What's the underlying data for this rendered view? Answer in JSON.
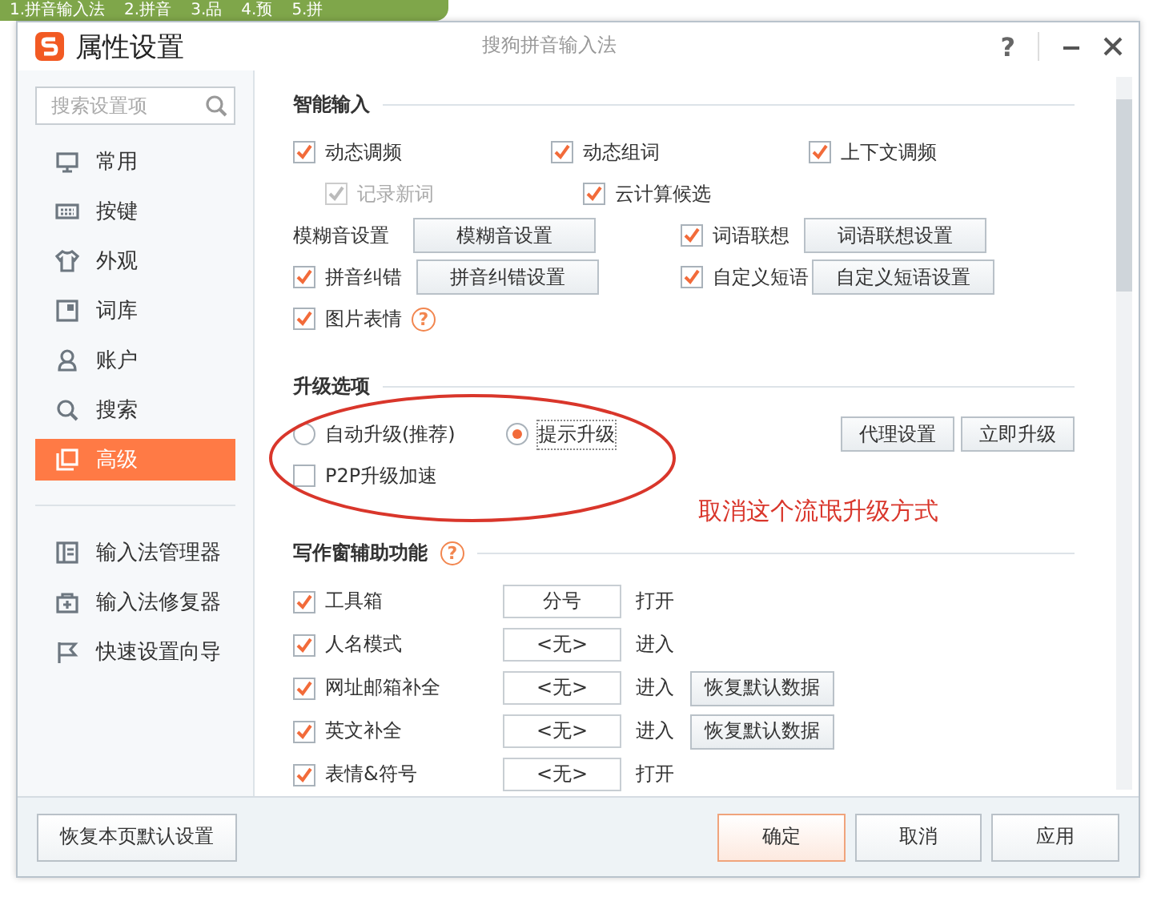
{
  "background": {
    "tabs": [
      "1.拼音输入法",
      "2.拼音",
      "3.品",
      "4.预",
      "5.拼"
    ]
  },
  "window": {
    "title": "属性设置",
    "subtitle": "搜狗拼音输入法",
    "help": "?"
  },
  "sidebar": {
    "search": {
      "placeholder": "搜索设置项"
    },
    "items": [
      {
        "label": "常用",
        "selected": false
      },
      {
        "label": "按键",
        "selected": false
      },
      {
        "label": "外观",
        "selected": false
      },
      {
        "label": "词库",
        "selected": false
      },
      {
        "label": "账户",
        "selected": false
      },
      {
        "label": "搜索",
        "selected": false
      },
      {
        "label": "高级",
        "selected": true
      }
    ],
    "tools": [
      "输入法管理器",
      "输入法修复器",
      "快速设置向导"
    ]
  },
  "smart_input": {
    "title": "智能输入",
    "options": [
      {
        "label": "动态调频",
        "checked": true,
        "disabled": false
      },
      {
        "label": "动态组词",
        "checked": true,
        "disabled": false
      },
      {
        "label": "上下文调频",
        "checked": true,
        "disabled": false
      }
    ],
    "sub_options": [
      {
        "label": "记录新词",
        "checked": true,
        "disabled": true
      },
      {
        "label": "云计算候选",
        "checked": true,
        "disabled": false
      }
    ],
    "settings": [
      {
        "kind": "label",
        "label": "模糊音设置",
        "button": "模糊音设置"
      },
      {
        "kind": "check",
        "label": "词语联想",
        "checked": true,
        "button": "词语联想设置"
      },
      {
        "kind": "check",
        "label": "拼音纠错",
        "checked": true,
        "button": "拼音纠错设置"
      },
      {
        "kind": "check",
        "label": "自定义短语",
        "checked": true,
        "button": "自定义短语设置"
      }
    ],
    "emoji": {
      "label": "图片表情",
      "checked": true,
      "help": "?"
    }
  },
  "upgrade": {
    "title": "升级选项",
    "modes": [
      {
        "label": "自动升级(推荐)",
        "selected": false
      },
      {
        "label": "提示升级",
        "selected": true
      }
    ],
    "p2p": {
      "label": "P2P升级加速",
      "checked": false
    },
    "buttons": [
      "代理设置",
      "立即升级"
    ]
  },
  "writing": {
    "title": "写作窗辅助功能",
    "help": "?",
    "rows": [
      {
        "label": "工具箱",
        "checked": true,
        "hotkey": "分号",
        "action": "打开"
      },
      {
        "label": "人名模式",
        "checked": true,
        "hotkey": "<无>",
        "action": "进入"
      },
      {
        "label": "网址邮箱补全",
        "checked": true,
        "hotkey": "<无>",
        "action": "进入",
        "restore": "恢复默认数据"
      },
      {
        "label": "英文补全",
        "checked": true,
        "hotkey": "<无>",
        "action": "进入",
        "restore": "恢复默认数据"
      },
      {
        "label": "表情&符号",
        "checked": true,
        "hotkey": "<无>",
        "action": "打开"
      }
    ]
  },
  "annotation": {
    "note": "取消这个流氓升级方式"
  },
  "footer": {
    "reset": "恢复本页默认设置",
    "buttons": [
      {
        "label": "确定",
        "primary": true
      },
      {
        "label": "取消",
        "primary": false
      },
      {
        "label": "应用",
        "primary": false
      }
    ]
  }
}
